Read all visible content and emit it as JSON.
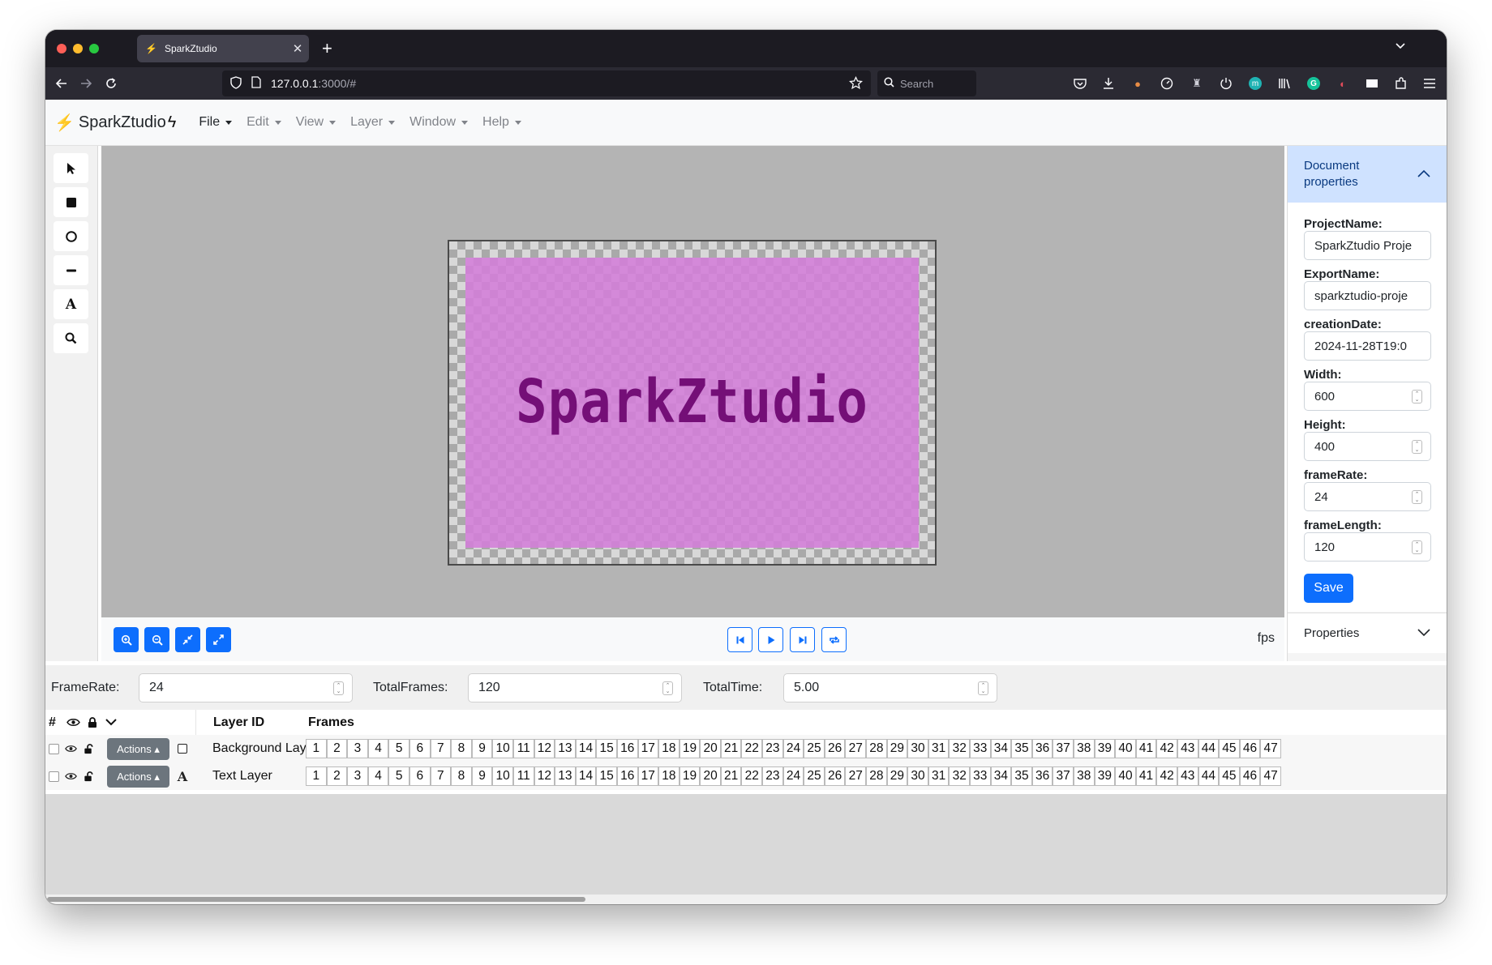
{
  "browser": {
    "tab_title": "SparkZtudio",
    "tab_icon": "bolt-icon",
    "new_tab_label": "+",
    "url_host": "127.0.0.1",
    "url_path": ":3000/#",
    "search_placeholder": "Search"
  },
  "app": {
    "brand_prefix": "⚡",
    "brand_name": "SparkZtudio",
    "brand_suffix": "ϟ",
    "menu": [
      "File",
      "Edit",
      "View",
      "Layer",
      "Window",
      "Help"
    ]
  },
  "tools": [
    "select-arrow-icon",
    "rectangle-icon",
    "circle-icon",
    "line-icon",
    "text-icon",
    "zoom-icon"
  ],
  "canvas": {
    "stage_text": "SparkZtudio",
    "background_color": "#d37dd8",
    "text_color": "#740f77"
  },
  "canvas_toolbar": {
    "zoom_buttons": [
      "zoom-in-icon",
      "zoom-out-icon",
      "fit-icon",
      "expand-icon"
    ],
    "playback_buttons": [
      "skip-back-icon",
      "play-icon",
      "skip-forward-icon",
      "loop-icon"
    ],
    "fps_label": "fps"
  },
  "document_properties": {
    "title": "Document properties",
    "fields": [
      {
        "label": "ProjectName:",
        "value": "SparkZtudio Proje"
      },
      {
        "label": "ExportName:",
        "value": "sparkztudio-proje"
      },
      {
        "label": "creationDate:",
        "value": "2024-11-28T19:0"
      },
      {
        "label": "Width:",
        "value": "600"
      },
      {
        "label": "Height:",
        "value": "400"
      },
      {
        "label": "frameRate:",
        "value": "24"
      },
      {
        "label": "frameLength:",
        "value": "120"
      }
    ],
    "save_label": "Save"
  },
  "properties_panel": {
    "title": "Properties"
  },
  "timeline": {
    "framerate_label": "FrameRate:",
    "framerate_value": "24",
    "totalframes_label": "TotalFrames:",
    "totalframes_value": "120",
    "totaltime_label": "TotalTime:",
    "totaltime_value": "5.00",
    "headers": {
      "index": "#",
      "layer_id": "Layer ID",
      "frames": "Frames"
    },
    "actions_label": "Actions ▴",
    "layers": [
      {
        "name": "Background Layer",
        "icon": "square-icon"
      },
      {
        "name": "Text Layer",
        "icon": "text-icon"
      }
    ],
    "frames_shown": [
      "1",
      "2",
      "3",
      "4",
      "5",
      "6",
      "7",
      "8",
      "9",
      "10",
      "11",
      "12",
      "13",
      "14",
      "15",
      "16",
      "17",
      "18",
      "19",
      "20",
      "21",
      "22",
      "23",
      "24",
      "25",
      "26",
      "27",
      "28",
      "29",
      "30",
      "31",
      "32",
      "33",
      "34",
      "35",
      "36",
      "37",
      "38",
      "39",
      "40",
      "41",
      "42",
      "43",
      "44",
      "45",
      "46",
      "47"
    ]
  }
}
